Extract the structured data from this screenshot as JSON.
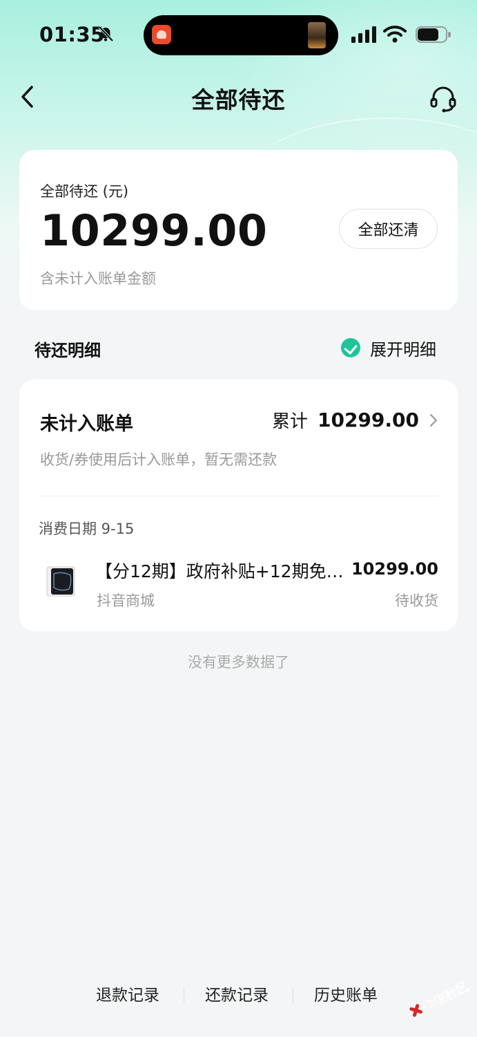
{
  "status_bar": {
    "time": "01:35"
  },
  "nav": {
    "title": "全部待还"
  },
  "summary": {
    "label": "全部待还 (元)",
    "amount": "10299.00",
    "note": "含未计入账单金额",
    "pay_all_label": "全部还清"
  },
  "details": {
    "section_title": "待还明细",
    "expand_label": "展开明细",
    "unbilled": {
      "title": "未计入账单",
      "total_label": "累计",
      "total_amount": "10299.00",
      "description": "收货/券使用后计入账单，暂无需还款"
    },
    "groups": [
      {
        "date_label": "消费日期 9-15",
        "orders": [
          {
            "title": "【分12期】政府补贴+12期免…",
            "amount": "10299.00",
            "shop": "抖音商城",
            "status": "待收货"
          }
        ]
      }
    ],
    "no_more": "没有更多数据了"
  },
  "bottom_links": [
    "退款记录",
    "还款记录",
    "历史账单"
  ],
  "watermark": {
    "text": "卡农社区"
  },
  "colors": {
    "accent": "#20c49a",
    "header_gradient_top": "#a9f0df",
    "background": "#f4f5f7"
  }
}
